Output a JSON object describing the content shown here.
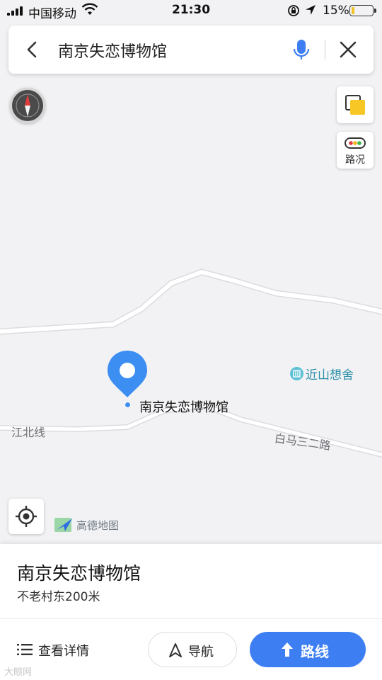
{
  "status_bar": {
    "carrier": "中国移动",
    "time": "21:30",
    "battery_percent": "15%",
    "battery_level": 0.15,
    "battery_color": "#f1c32b"
  },
  "search": {
    "query": "南京失恋博物馆",
    "back_icon": "chevron-left-icon",
    "mic_icon": "microphone-icon",
    "close_icon": "close-icon"
  },
  "map": {
    "traffic_label": "路况",
    "roads": [
      "江北线",
      "白马三二路"
    ],
    "poi": {
      "name": "近山想舍",
      "icon": "building-icon",
      "color": "#5cc0d6"
    },
    "marker": {
      "label": "南京失恋博物馆",
      "color": "#3d8ef2"
    },
    "logo_text": "高德地图"
  },
  "place_card": {
    "title": "南京失恋博物馆",
    "subtitle": "不老村东200米",
    "details_label": "查看详情",
    "navigate_label": "导航",
    "route_label": "路线",
    "accent_color": "#3d7ff3"
  },
  "watermark": "大眼网"
}
